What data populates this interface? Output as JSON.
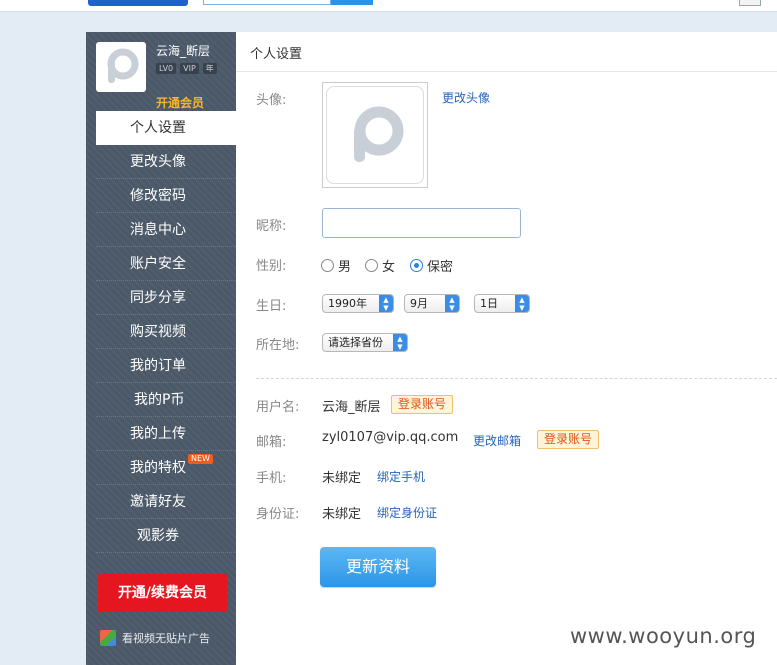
{
  "profile": {
    "username": "云海_断层",
    "badges": [
      "LV0",
      "VIP",
      "年"
    ],
    "vip_link": "开通会员"
  },
  "sidebar": {
    "items": [
      {
        "label": "个人设置",
        "active": true
      },
      {
        "label": "更改头像"
      },
      {
        "label": "修改密码"
      },
      {
        "label": "消息中心"
      },
      {
        "label": "账户安全"
      },
      {
        "label": "同步分享"
      },
      {
        "label": "购买视频"
      },
      {
        "label": "我的订单"
      },
      {
        "label": "我的P币"
      },
      {
        "label": "我的上传"
      },
      {
        "label": "我的特权",
        "badge": "NEW"
      },
      {
        "label": "邀请好友"
      },
      {
        "label": "观影券"
      }
    ],
    "renew_button": "开通/续费会员",
    "ad_text": "看视频无贴片广告"
  },
  "main": {
    "title": "个人设置",
    "avatar": {
      "label": "头像:",
      "change_link": "更改头像"
    },
    "nickname": {
      "label": "昵称:",
      "value": ""
    },
    "gender": {
      "label": "性别:",
      "options": [
        "男",
        "女",
        "保密"
      ],
      "selected": "保密"
    },
    "birthday": {
      "label": "生日:",
      "year": "1990年",
      "month": "9月",
      "day": "1日"
    },
    "location": {
      "label": "所在地:",
      "value": "请选择省份"
    },
    "account": {
      "label": "用户名:",
      "value": "云海_断层",
      "tag": "登录账号"
    },
    "email": {
      "label": "邮箱:",
      "value": "zyl0107@vip.qq.com",
      "change_link": "更改邮箱",
      "tag": "登录账号"
    },
    "phone": {
      "label": "手机:",
      "value": "未绑定",
      "link": "绑定手机"
    },
    "idcard": {
      "label": "身份证:",
      "value": "未绑定",
      "link": "绑定身份证"
    },
    "submit": "更新资料"
  },
  "watermark": "www.wooyun.org",
  "colors": {
    "accent": "#2f7fdc",
    "sidebar_bg": "#4b5868",
    "vip_gold": "#f5b52a",
    "renew_red": "#e5161f",
    "link_blue": "#2764b8"
  }
}
